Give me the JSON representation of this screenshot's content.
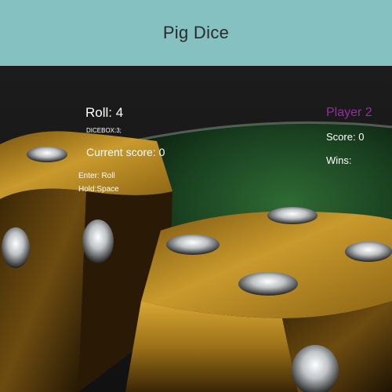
{
  "header": {
    "title": "Pig Dice"
  },
  "game": {
    "roll_label": "Roll:",
    "roll_value": "4",
    "dicebox_label": "DICEBOX:3;",
    "current_score_label": "Current score:",
    "current_score_value": "0",
    "controls": {
      "roll_hint": "Enter: Roll",
      "hold_hint": "Hold:Space"
    }
  },
  "player": {
    "name": "Player 2",
    "score_label": "Score:",
    "score_value": "0",
    "wins_label": "Wins:",
    "wins_value": ""
  },
  "colors": {
    "header_background": "#86c1c2",
    "player_name": "#9b2aa6",
    "felt": "#1e4a25",
    "gold": "#b88a22"
  },
  "scene": {
    "background_image": "two golden dice on a green table",
    "die_front_pips_visible": 4
  }
}
